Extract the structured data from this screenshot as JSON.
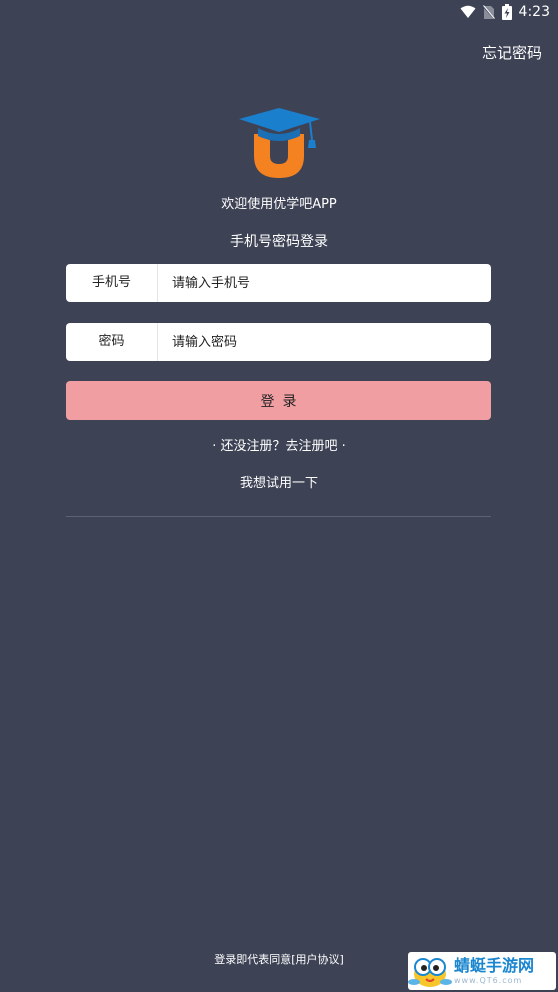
{
  "status_bar": {
    "time": "4:23",
    "icons": [
      "wifi-icon",
      "no-sim-icon",
      "battery-charging-icon"
    ]
  },
  "header": {
    "forgot_password": "忘记密码"
  },
  "logo": {
    "icon": "graduation-cap-u-logo",
    "colors": {
      "cap": "#1a7fcd",
      "letter": "#f58220"
    }
  },
  "welcome_text": "欢迎使用优学吧APP",
  "login_mode": "手机号密码登录",
  "form": {
    "phone_label": "手机号",
    "phone_placeholder": "请输入手机号",
    "phone_value": "",
    "password_label": "密码",
    "password_placeholder": "请输入密码",
    "password_value": "",
    "submit_label": "登录"
  },
  "register_link": "· 还没注册？去注册吧 ·",
  "trial_link": "我想试用一下",
  "agreement": {
    "prefix": "登录即代表同意",
    "link": "[用户协议]"
  },
  "watermark": {
    "title": "蜻蜓手游网",
    "url": "www.QT6.com"
  },
  "colors": {
    "background": "#3d4255",
    "login_button": "#f19ea2",
    "field_background": "#ffffff"
  }
}
